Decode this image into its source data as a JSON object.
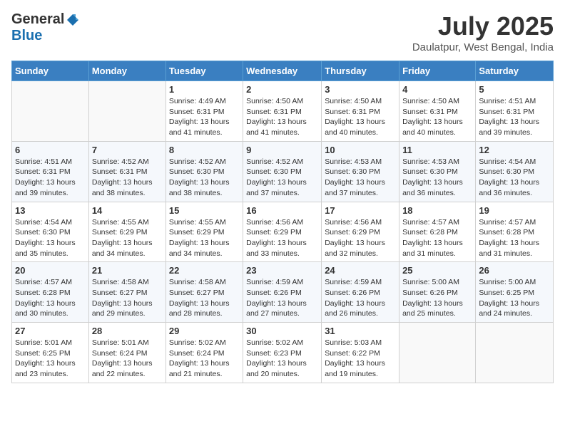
{
  "logo": {
    "general": "General",
    "blue": "Blue"
  },
  "title": {
    "month": "July 2025",
    "location": "Daulatpur, West Bengal, India"
  },
  "weekdays": [
    "Sunday",
    "Monday",
    "Tuesday",
    "Wednesday",
    "Thursday",
    "Friday",
    "Saturday"
  ],
  "weeks": [
    [
      {
        "day": "",
        "info": ""
      },
      {
        "day": "",
        "info": ""
      },
      {
        "day": "1",
        "info": "Sunrise: 4:49 AM\nSunset: 6:31 PM\nDaylight: 13 hours and 41 minutes."
      },
      {
        "day": "2",
        "info": "Sunrise: 4:50 AM\nSunset: 6:31 PM\nDaylight: 13 hours and 41 minutes."
      },
      {
        "day": "3",
        "info": "Sunrise: 4:50 AM\nSunset: 6:31 PM\nDaylight: 13 hours and 40 minutes."
      },
      {
        "day": "4",
        "info": "Sunrise: 4:50 AM\nSunset: 6:31 PM\nDaylight: 13 hours and 40 minutes."
      },
      {
        "day": "5",
        "info": "Sunrise: 4:51 AM\nSunset: 6:31 PM\nDaylight: 13 hours and 39 minutes."
      }
    ],
    [
      {
        "day": "6",
        "info": "Sunrise: 4:51 AM\nSunset: 6:31 PM\nDaylight: 13 hours and 39 minutes."
      },
      {
        "day": "7",
        "info": "Sunrise: 4:52 AM\nSunset: 6:31 PM\nDaylight: 13 hours and 38 minutes."
      },
      {
        "day": "8",
        "info": "Sunrise: 4:52 AM\nSunset: 6:30 PM\nDaylight: 13 hours and 38 minutes."
      },
      {
        "day": "9",
        "info": "Sunrise: 4:52 AM\nSunset: 6:30 PM\nDaylight: 13 hours and 37 minutes."
      },
      {
        "day": "10",
        "info": "Sunrise: 4:53 AM\nSunset: 6:30 PM\nDaylight: 13 hours and 37 minutes."
      },
      {
        "day": "11",
        "info": "Sunrise: 4:53 AM\nSunset: 6:30 PM\nDaylight: 13 hours and 36 minutes."
      },
      {
        "day": "12",
        "info": "Sunrise: 4:54 AM\nSunset: 6:30 PM\nDaylight: 13 hours and 36 minutes."
      }
    ],
    [
      {
        "day": "13",
        "info": "Sunrise: 4:54 AM\nSunset: 6:30 PM\nDaylight: 13 hours and 35 minutes."
      },
      {
        "day": "14",
        "info": "Sunrise: 4:55 AM\nSunset: 6:29 PM\nDaylight: 13 hours and 34 minutes."
      },
      {
        "day": "15",
        "info": "Sunrise: 4:55 AM\nSunset: 6:29 PM\nDaylight: 13 hours and 34 minutes."
      },
      {
        "day": "16",
        "info": "Sunrise: 4:56 AM\nSunset: 6:29 PM\nDaylight: 13 hours and 33 minutes."
      },
      {
        "day": "17",
        "info": "Sunrise: 4:56 AM\nSunset: 6:29 PM\nDaylight: 13 hours and 32 minutes."
      },
      {
        "day": "18",
        "info": "Sunrise: 4:57 AM\nSunset: 6:28 PM\nDaylight: 13 hours and 31 minutes."
      },
      {
        "day": "19",
        "info": "Sunrise: 4:57 AM\nSunset: 6:28 PM\nDaylight: 13 hours and 31 minutes."
      }
    ],
    [
      {
        "day": "20",
        "info": "Sunrise: 4:57 AM\nSunset: 6:28 PM\nDaylight: 13 hours and 30 minutes."
      },
      {
        "day": "21",
        "info": "Sunrise: 4:58 AM\nSunset: 6:27 PM\nDaylight: 13 hours and 29 minutes."
      },
      {
        "day": "22",
        "info": "Sunrise: 4:58 AM\nSunset: 6:27 PM\nDaylight: 13 hours and 28 minutes."
      },
      {
        "day": "23",
        "info": "Sunrise: 4:59 AM\nSunset: 6:26 PM\nDaylight: 13 hours and 27 minutes."
      },
      {
        "day": "24",
        "info": "Sunrise: 4:59 AM\nSunset: 6:26 PM\nDaylight: 13 hours and 26 minutes."
      },
      {
        "day": "25",
        "info": "Sunrise: 5:00 AM\nSunset: 6:26 PM\nDaylight: 13 hours and 25 minutes."
      },
      {
        "day": "26",
        "info": "Sunrise: 5:00 AM\nSunset: 6:25 PM\nDaylight: 13 hours and 24 minutes."
      }
    ],
    [
      {
        "day": "27",
        "info": "Sunrise: 5:01 AM\nSunset: 6:25 PM\nDaylight: 13 hours and 23 minutes."
      },
      {
        "day": "28",
        "info": "Sunrise: 5:01 AM\nSunset: 6:24 PM\nDaylight: 13 hours and 22 minutes."
      },
      {
        "day": "29",
        "info": "Sunrise: 5:02 AM\nSunset: 6:24 PM\nDaylight: 13 hours and 21 minutes."
      },
      {
        "day": "30",
        "info": "Sunrise: 5:02 AM\nSunset: 6:23 PM\nDaylight: 13 hours and 20 minutes."
      },
      {
        "day": "31",
        "info": "Sunrise: 5:03 AM\nSunset: 6:22 PM\nDaylight: 13 hours and 19 minutes."
      },
      {
        "day": "",
        "info": ""
      },
      {
        "day": "",
        "info": ""
      }
    ]
  ]
}
